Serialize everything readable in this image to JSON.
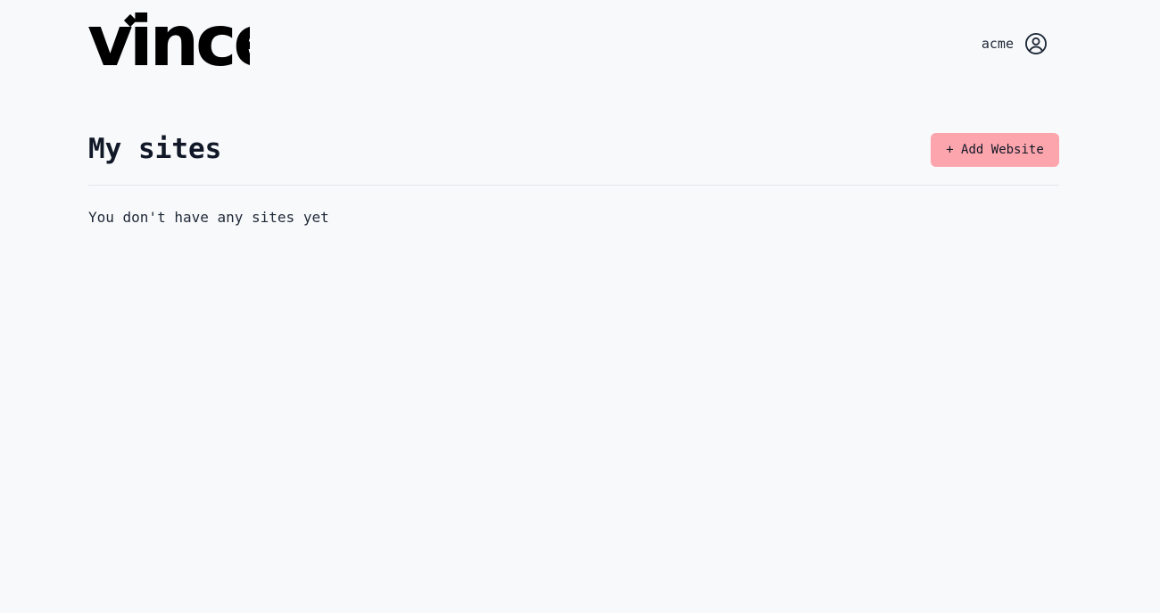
{
  "brand": {
    "name": "vince",
    "color": "#000000"
  },
  "header": {
    "user_name": "acme",
    "user_icon": "user-circle-icon"
  },
  "main": {
    "title": "My sites",
    "add_button_label": "+ Add Website",
    "empty_message": "You don't have any sites yet"
  },
  "colors": {
    "background": "#f8f9fb",
    "accent": "#fca5ad",
    "text": "#1f2937",
    "divider": "#e2e5ea"
  }
}
